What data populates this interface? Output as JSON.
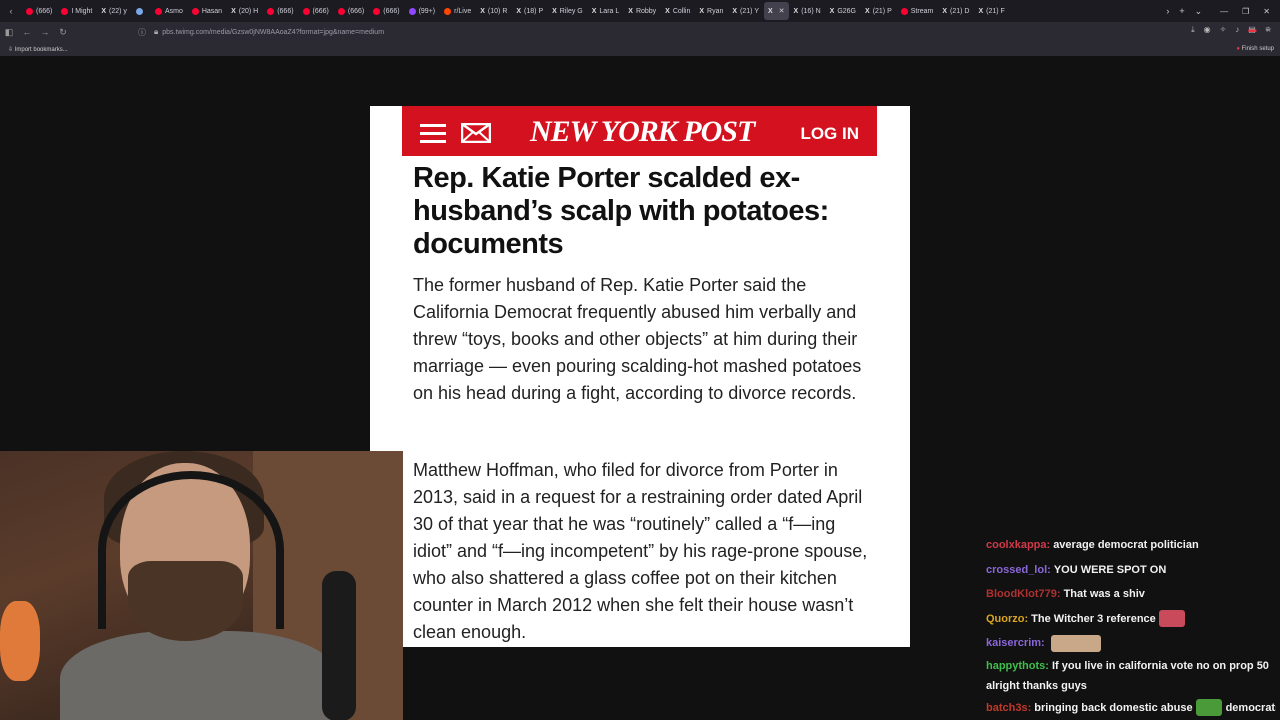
{
  "browser": {
    "tabs": [
      {
        "label": "(666)",
        "icon": "youtube-icon",
        "color": "#ff0033"
      },
      {
        "label": "I Might",
        "icon": "youtube-icon",
        "color": "#ff0033"
      },
      {
        "label": "(22) y",
        "icon": "x-icon",
        "color": "#dddddd"
      },
      {
        "label": "",
        "icon": "page-icon",
        "color": "#7aa8e6"
      },
      {
        "label": "Asmo",
        "icon": "twitch-icon",
        "color": "#ff0033"
      },
      {
        "label": "Hasan",
        "icon": "twitch-icon",
        "color": "#ff0033"
      },
      {
        "label": "(20) H",
        "icon": "x-icon",
        "color": "#dddddd"
      },
      {
        "label": "(666)",
        "icon": "youtube-icon",
        "color": "#ff0033"
      },
      {
        "label": "(666)",
        "icon": "youtube-icon",
        "color": "#ff0033"
      },
      {
        "label": "(666)",
        "icon": "youtube-icon",
        "color": "#ff0033"
      },
      {
        "label": "(666)",
        "icon": "youtube-icon",
        "color": "#ff0033"
      },
      {
        "label": "(99+)",
        "icon": "twitch-icon",
        "color": "#9146ff"
      },
      {
        "label": "r/Live",
        "icon": "reddit-icon",
        "color": "#ff4500"
      },
      {
        "label": "(10) R",
        "icon": "x-icon",
        "color": "#dddddd"
      },
      {
        "label": "(18) P",
        "icon": "x-icon",
        "color": "#dddddd"
      },
      {
        "label": "Riley G",
        "icon": "x-icon",
        "color": "#dddddd"
      },
      {
        "label": "Lara L",
        "icon": "x-icon",
        "color": "#dddddd"
      },
      {
        "label": "Robby",
        "icon": "x-icon",
        "color": "#dddddd"
      },
      {
        "label": "Collin",
        "icon": "x-icon",
        "color": "#dddddd"
      },
      {
        "label": "Ryan",
        "icon": "x-icon",
        "color": "#dddddd"
      },
      {
        "label": "(21) Y",
        "icon": "x-icon",
        "color": "#dddddd"
      },
      {
        "label": "",
        "icon": "x-icon",
        "color": "#dddddd",
        "active": true
      },
      {
        "label": "(16) N",
        "icon": "x-icon",
        "color": "#dddddd"
      },
      {
        "label": "G26G",
        "icon": "x-icon",
        "color": "#dddddd"
      },
      {
        "label": "(21) P",
        "icon": "x-icon",
        "color": "#dddddd"
      },
      {
        "label": "Stream",
        "icon": "youtube-icon",
        "color": "#ff0033"
      },
      {
        "label": "(21) D",
        "icon": "x-icon",
        "color": "#dddddd"
      },
      {
        "label": "(21) F",
        "icon": "x-icon",
        "color": "#dddddd"
      }
    ],
    "url": "pbs.twimg.com/media/Gzsw0jNW8AAoaZ4?format=jpg&name=medium",
    "bookmarks": {
      "import_label": "Import bookmarks...",
      "finish_setup_label": "Finish setup"
    }
  },
  "article": {
    "brand": "NEW YORK POST",
    "login_label": "LOG IN",
    "headline": "Rep. Katie Porter scalded ex-husband’s scalp with potatoes: documents",
    "paragraph1": "The former husband of Rep. Katie Porter said the California Democrat frequently abused him verbally and threw “toys, books and other objects” at him during their marriage — even pouring scalding-hot mashed potatoes on his head during a fight, according to divorce records.",
    "paragraph2": "Matthew Hoffman, who filed for divorce from Porter in 2013, said in a request for a restraining order dated April 30 of that year that he was “routinely” called a “f—ing idiot” and “f—ing incompetent” by his rage-prone spouse, who also shattered a glass coffee pot on their kitchen counter in March 2012 when she felt their house wasn’t clean enough.",
    "colors": {
      "brand_red": "#d4121f"
    }
  },
  "chat": {
    "messages": [
      {
        "user": "coolxkappa:",
        "color": "#d0394a",
        "text": "average democrat politician"
      },
      {
        "user": "crossed_lol:",
        "color": "#8a67d9",
        "text": "YOU WERE SPOT ON"
      },
      {
        "user": "BloodKlot779:",
        "color": "#b03030",
        "text": "That was a shiv"
      },
      {
        "user": "Quorzo:",
        "color": "#d9a520",
        "text": "The Witcher 3 reference",
        "emote": "lips-emote"
      },
      {
        "user": "kaisercrim:",
        "color": "#8a67d9",
        "text": "",
        "emote": "faces-emote"
      },
      {
        "user": "happythots:",
        "color": "#3fbf4a",
        "text": "If you live in california vote no on prop 50 alright thanks guys",
        "wrap": true
      },
      {
        "user": "batch3s:",
        "color": "#c0392b",
        "text": "bringing back domestic abuse",
        "emote": "pepe-emote",
        "after": "democrats"
      }
    ]
  }
}
